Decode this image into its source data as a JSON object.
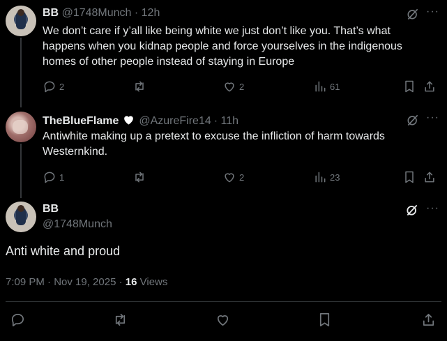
{
  "tweets": [
    {
      "name": "BB",
      "handle": "@1748Munch",
      "time": "· 12h",
      "text": "We don’t care if y’all like being white we just don’t like you. That’s what happens when you kidnap people and force yourselves in the indigenous homes of other people instead of staying in Europe",
      "replies": "2",
      "reposts": "",
      "likes": "2",
      "views": "61"
    },
    {
      "name": "TheBlueFlame",
      "handle": "@AzureFire14",
      "time": "· 11h",
      "text": "Antiwhite making up a pretext to excuse the infliction of harm towards Westernkind.",
      "replies": "1",
      "reposts": "",
      "likes": "2",
      "views": "23"
    }
  ],
  "main": {
    "name": "BB",
    "handle": "@1748Munch",
    "text": "Anti white and proud",
    "timestamp": "7:09 PM · Nov 19, 2025 ·",
    "views_count": "16",
    "views_label": "Views"
  },
  "icons": {
    "reply": "reply-icon",
    "repost": "repost-icon",
    "like": "heart-icon",
    "views": "views-icon",
    "bookmark": "bookmark-icon",
    "share": "share-icon",
    "grok": "grok-icon",
    "more": "more-icon",
    "heart_emoji": "white-heart-emoji"
  },
  "colors": {
    "background": "#000000",
    "text": "#e7e9ea",
    "muted": "#71767b",
    "divider": "#2f3336"
  }
}
